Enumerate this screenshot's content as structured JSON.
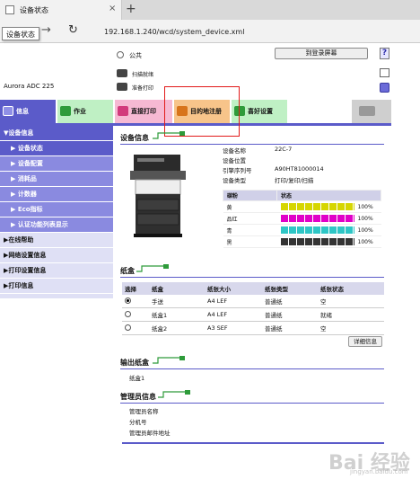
{
  "browser": {
    "tab_title": "设备状态",
    "tab_close": "×",
    "new_tab": "+",
    "tooltip": "设备状态",
    "forward": "→",
    "refresh": "↻",
    "url": "192.168.1.240/wcd/system_device.xml"
  },
  "header": {
    "user_label": "公共",
    "login_button": "到登录屏幕",
    "help": "?",
    "status_scan": "扫描就绪",
    "status_print": "准备打印",
    "model": "Aurora ADC 225"
  },
  "tabs": [
    {
      "label": "信息",
      "color": "#5b5bc9"
    },
    {
      "label": "作业",
      "color": "#bff0c4"
    },
    {
      "label": "直接打印",
      "color": "#f6b9d3"
    },
    {
      "label": "目的地注册",
      "color": "#f7c48a"
    },
    {
      "label": "喜好设置",
      "color": "#bff0c4"
    }
  ],
  "sidebar": [
    {
      "label": "▼设备信息",
      "kind": "top"
    },
    {
      "label": "▶ 设备状态",
      "kind": "sub-active"
    },
    {
      "label": "▶ 设备配置",
      "kind": "sub"
    },
    {
      "label": "▶ 消耗品",
      "kind": "sub"
    },
    {
      "label": "▶ 计数器",
      "kind": "sub"
    },
    {
      "label": "▶ Eco指标",
      "kind": "sub"
    },
    {
      "label": "▶ 认证功能列表显示",
      "kind": "sub"
    },
    {
      "label": "▶在线帮助",
      "kind": "main"
    },
    {
      "label": "▶网络设置信息",
      "kind": "main"
    },
    {
      "label": "▶打印设置信息",
      "kind": "main"
    },
    {
      "label": "▶打印信息",
      "kind": "main"
    }
  ],
  "device": {
    "title": "设备信息",
    "fields": [
      {
        "label": "设备名称",
        "value": "22C-7"
      },
      {
        "label": "设备位置",
        "value": ""
      },
      {
        "label": "引擎序列号",
        "value": "A90HT81000014"
      },
      {
        "label": "设备类型",
        "value": "打印/复印/扫描"
      }
    ],
    "toner_headers": [
      "碳粉",
      "状态"
    ],
    "toner": [
      {
        "name": "黄",
        "level": 100,
        "pct": "100%",
        "color": "#d6d600"
      },
      {
        "name": "品红",
        "level": 100,
        "pct": "100%",
        "color": "#e000c8"
      },
      {
        "name": "青",
        "level": 100,
        "pct": "100%",
        "color": "#2ec6c6"
      },
      {
        "name": "黑",
        "level": 100,
        "pct": "100%",
        "color": "#333333"
      }
    ]
  },
  "trays": {
    "title": "纸盒",
    "headers": [
      "选择",
      "纸盒",
      "纸张大小",
      "纸张类型",
      "纸张状态"
    ],
    "rows": [
      {
        "selected": true,
        "name": "手送",
        "size": "A4 LEF",
        "type": "普通纸",
        "status": "空"
      },
      {
        "selected": false,
        "name": "纸盒1",
        "size": "A4 LEF",
        "type": "普通纸",
        "status": "就绪"
      },
      {
        "selected": false,
        "name": "纸盒2",
        "size": "A3 SEF",
        "type": "普通纸",
        "status": "空"
      }
    ],
    "detail_button": "详细信息"
  },
  "output": {
    "title": "输出纸盒",
    "item": "纸盒1"
  },
  "admin": {
    "title": "管理员信息",
    "fields": [
      "管理员名称",
      "分机号",
      "管理员邮件地址"
    ]
  },
  "watermark": {
    "text": "Bai 经验",
    "sub": "jingyan.baidu.com"
  }
}
